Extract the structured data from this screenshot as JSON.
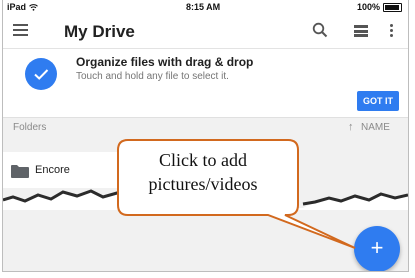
{
  "status_bar": {
    "device": "iPad",
    "time": "8:15 AM",
    "battery": "100%"
  },
  "app_bar": {
    "title": "My Drive"
  },
  "tip_card": {
    "title": "Organize files with drag & drop",
    "subtitle": "Touch and hold any file to select it.",
    "button_label": "GOT IT"
  },
  "list_header": {
    "section": "Folders",
    "sort_label": "NAME",
    "sort_arrow": "↑"
  },
  "folders": [
    {
      "name": "Encore"
    }
  ],
  "fab": {
    "symbol": "+"
  },
  "callout": {
    "line1": "Click to add",
    "line2": "pictures/videos"
  },
  "colors": {
    "accent": "#2f7cf0",
    "callout_border": "#d2691e",
    "callout_fill": "#ffffff"
  },
  "icons": [
    "wifi-icon",
    "battery-icon",
    "menu-icon",
    "search-icon",
    "list-view-icon",
    "more-vert-icon",
    "check-icon",
    "folder-icon",
    "add-icon"
  ]
}
